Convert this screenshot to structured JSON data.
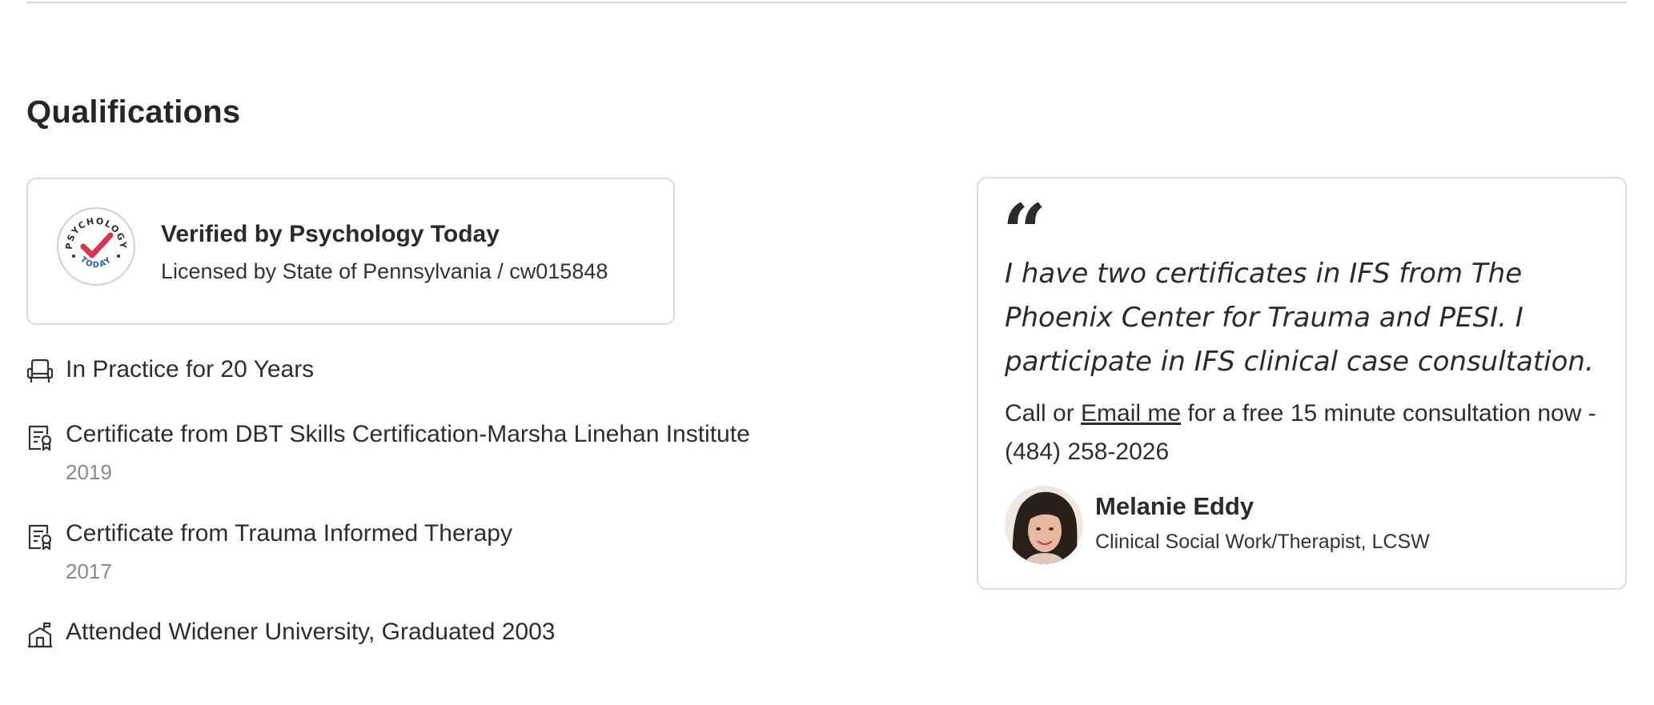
{
  "section": {
    "title": "Qualifications"
  },
  "verified": {
    "badge_icon": "psychology-today-badge",
    "badge_text_top": "PSYCHOLOGY",
    "badge_text_bottom": "TODAY",
    "badge_check_color": "#d8364f",
    "badge_ring_color": "#2a5ea7",
    "title": "Verified by Psychology Today",
    "license": "Licensed by State of Pennsylvania / cw015848"
  },
  "qualifications": [
    {
      "icon": "chair-icon",
      "text": "In Practice for 20 Years",
      "year": ""
    },
    {
      "icon": "certificate-icon",
      "text": "Certificate from DBT Skills Certification-Marsha Linehan Institute",
      "year": "2019"
    },
    {
      "icon": "certificate-icon",
      "text": "Certificate from Trauma Informed Therapy",
      "year": "2017"
    },
    {
      "icon": "school-icon",
      "text": "Attended Widener University, Graduated 2003",
      "year": ""
    }
  ],
  "quote": {
    "mark": "“",
    "text": "I have two certificates in IFS from The Phoenix Center for Trauma and PESI. I participate in IFS clinical case consultation.",
    "consult_prefix": "Call or",
    "email_link": "Email me",
    "consult_suffix": "for a free 15 minute consultation now - (484) 258-2026"
  },
  "therapist": {
    "name": "Melanie Eddy",
    "title": "Clinical Social Work/Therapist, LCSW"
  }
}
